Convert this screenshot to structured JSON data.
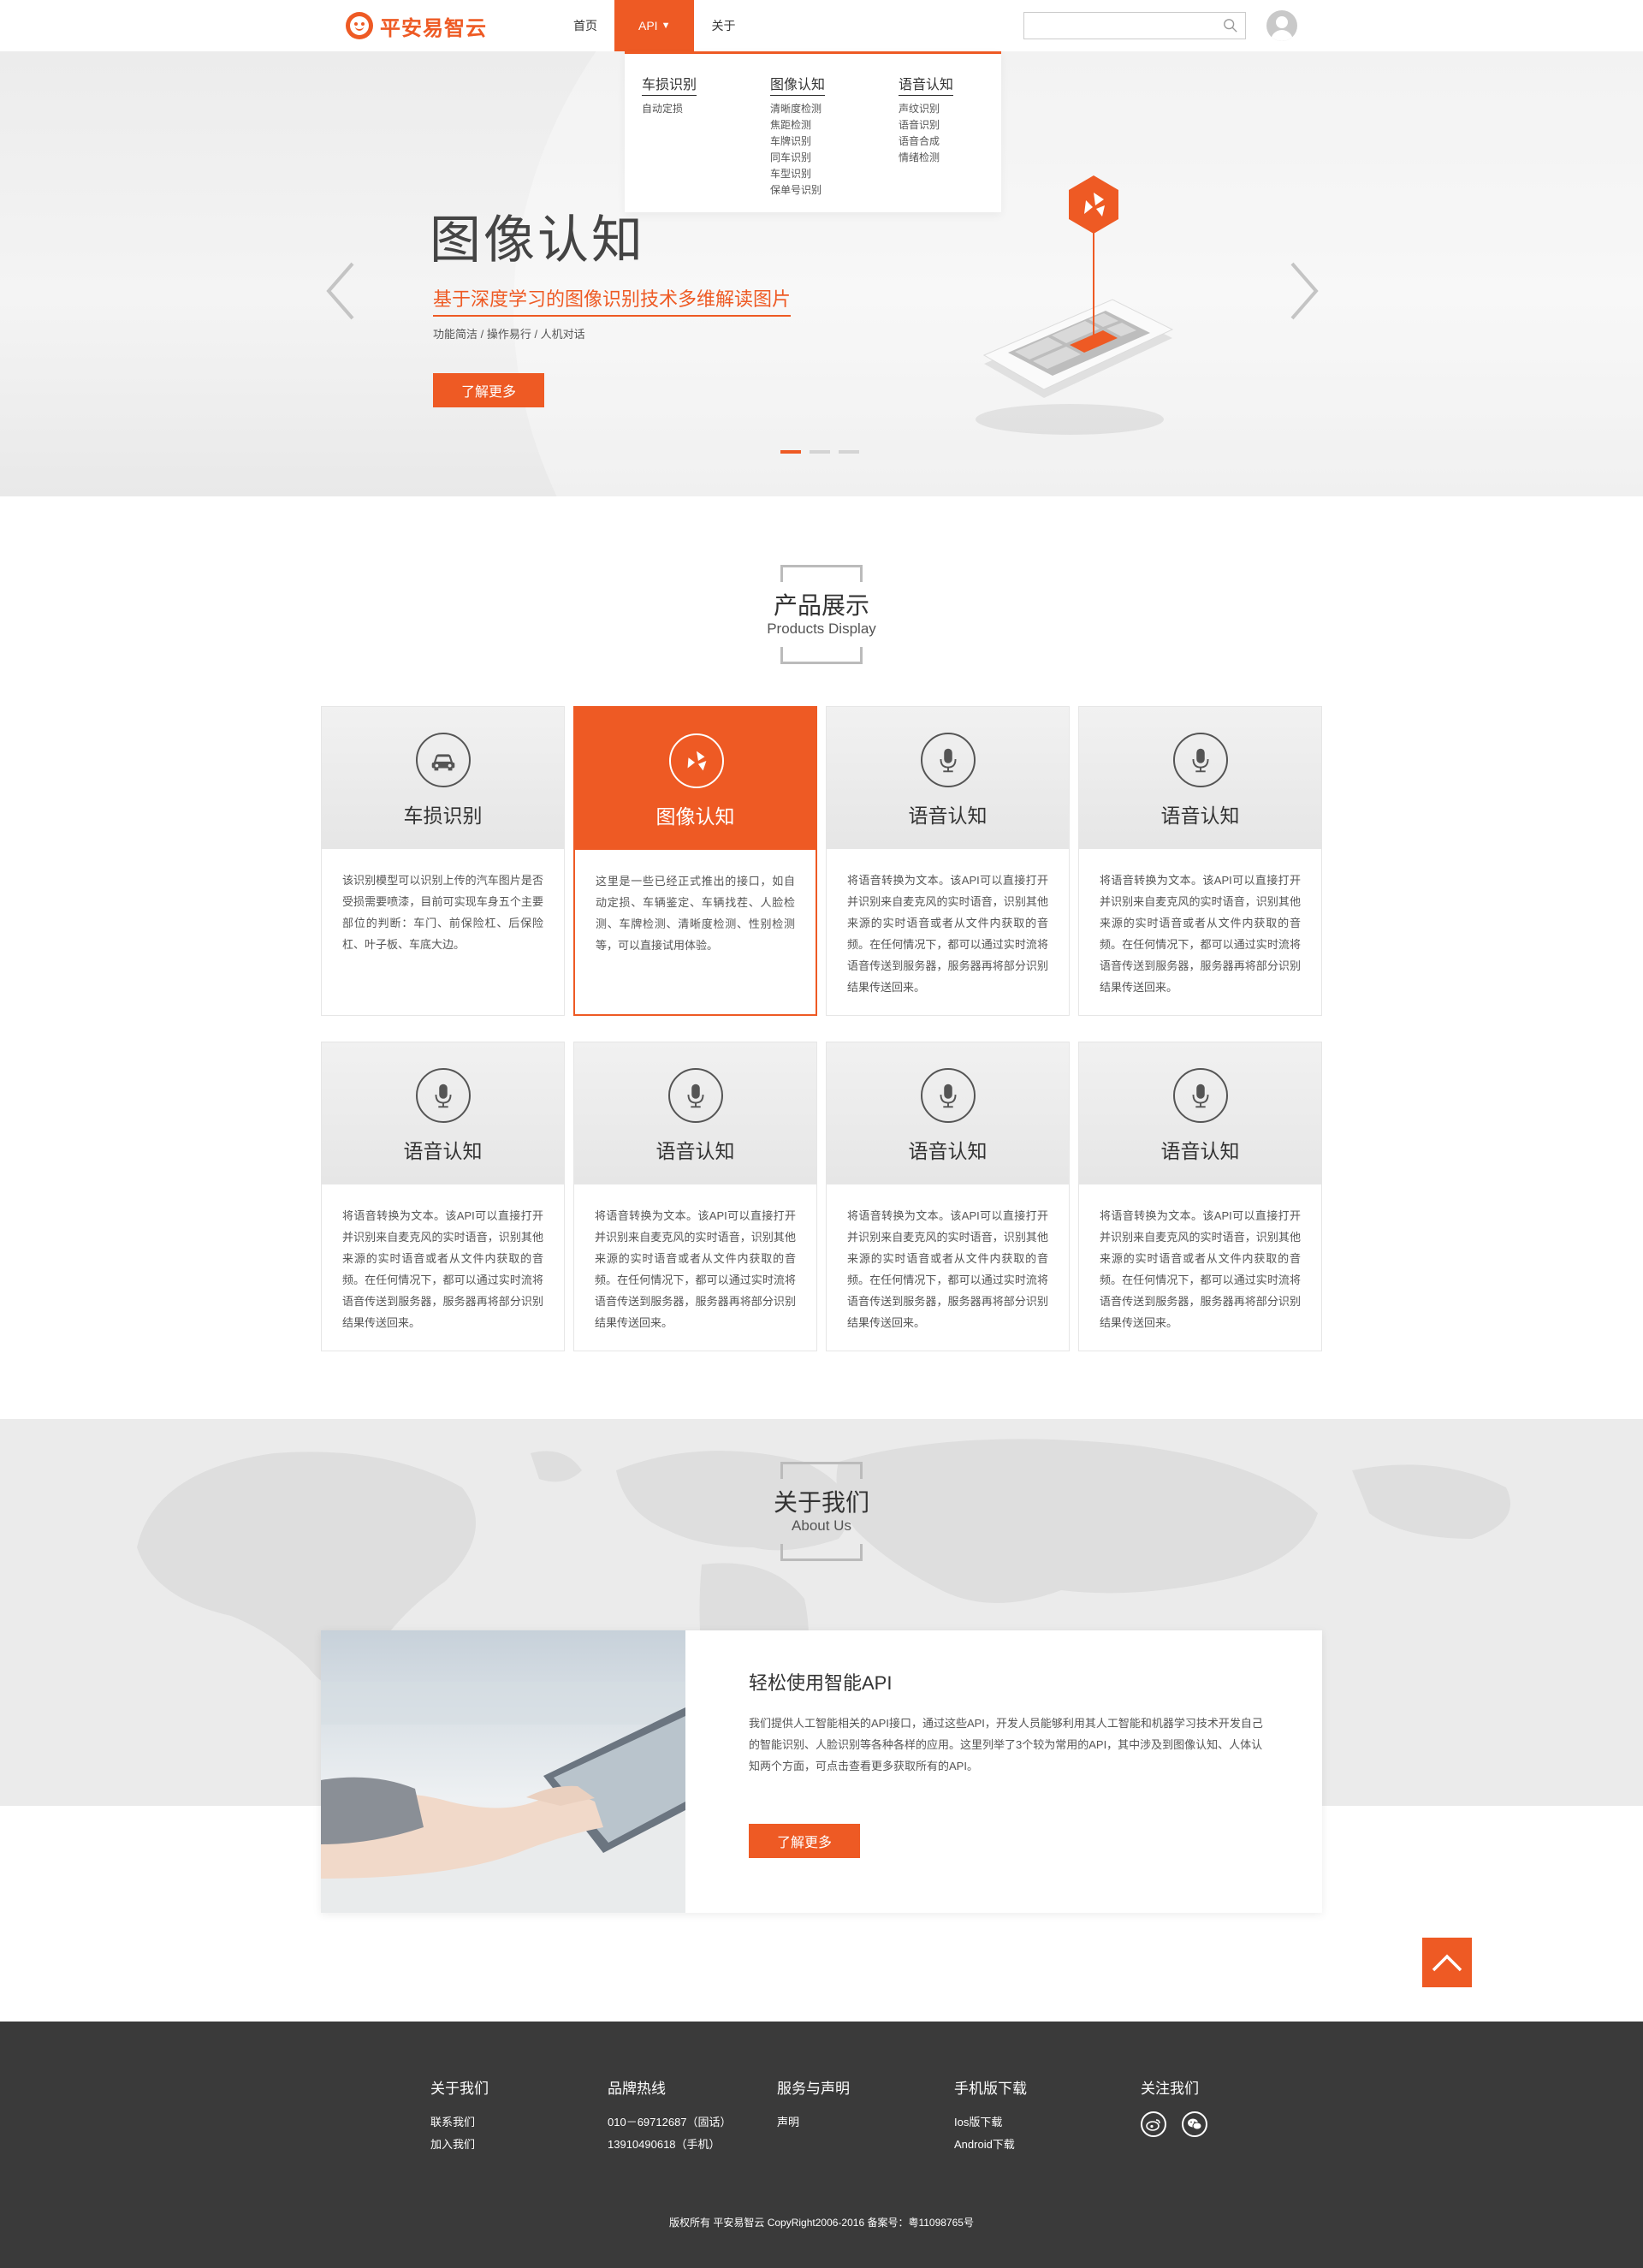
{
  "header": {
    "logo_text": "平安易智云",
    "nav": [
      {
        "label": "首页"
      },
      {
        "label": "API",
        "caret": "▼"
      },
      {
        "label": "关于"
      }
    ],
    "search_placeholder": ""
  },
  "dropdown": {
    "columns": [
      {
        "title": "车损识别",
        "items": [
          "自动定损"
        ]
      },
      {
        "title": "图像认知",
        "items": [
          "清晰度检测",
          "焦距检测",
          "车牌识别",
          "同车识别",
          "车型识别",
          "保单号识别"
        ]
      },
      {
        "title": "语音认知",
        "items": [
          "声纹识别",
          "语音识别",
          "语音合成",
          "情绪检测"
        ]
      }
    ]
  },
  "banner": {
    "title": "图像认知",
    "subtitle": "基于深度学习的图像识别技术多维解读图片",
    "desc": "功能简洁 / 操作易行 / 人机对话",
    "button": "了解更多",
    "slides_total": 3,
    "active_slide": 1
  },
  "products": {
    "title": "产品展示",
    "subtitle": "Products Display",
    "cards": [
      {
        "title": "车损识别",
        "icon": "car-icon",
        "text": "该识别模型可以识别上传的汽车图片是否受损需要喷漆，目前可实现车身五个主要部位的判断：车门、前保险杠、后保险杠、叶子板、车底大边。"
      },
      {
        "title": "图像认知",
        "icon": "image-cognition-icon",
        "text": "这里是一些已经正式推出的接口，如自动定损、车辆鉴定、车辆找茬、人脸检测、车牌检测、清晰度检测、性别检测等，可以直接试用体验。"
      },
      {
        "title": "语音认知",
        "icon": "microphone-icon",
        "text": "将语音转换为文本。该API可以直接打开并识别来自麦克风的实时语音，识别其他来源的实时语音或者从文件内获取的音频。在任何情况下，都可以通过实时流将语音传送到服务器，服务器再将部分识别结果传送回来。"
      },
      {
        "title": "语音认知",
        "icon": "microphone-icon",
        "text": "将语音转换为文本。该API可以直接打开并识别来自麦克风的实时语音，识别其他来源的实时语音或者从文件内获取的音频。在任何情况下，都可以通过实时流将语音传送到服务器，服务器再将部分识别结果传送回来。"
      },
      {
        "title": "语音认知",
        "icon": "microphone-icon",
        "text": "将语音转换为文本。该API可以直接打开并识别来自麦克风的实时语音，识别其他来源的实时语音或者从文件内获取的音频。在任何情况下，都可以通过实时流将语音传送到服务器，服务器再将部分识别结果传送回来。"
      },
      {
        "title": "语音认知",
        "icon": "microphone-icon",
        "text": "将语音转换为文本。该API可以直接打开并识别来自麦克风的实时语音，识别其他来源的实时语音或者从文件内获取的音频。在任何情况下，都可以通过实时流将语音传送到服务器，服务器再将部分识别结果传送回来。"
      },
      {
        "title": "语音认知",
        "icon": "microphone-icon",
        "text": "将语音转换为文本。该API可以直接打开并识别来自麦克风的实时语音，识别其他来源的实时语音或者从文件内获取的音频。在任何情况下，都可以通过实时流将语音传送到服务器，服务器再将部分识别结果传送回来。"
      },
      {
        "title": "语音认知",
        "icon": "microphone-icon",
        "text": "将语音转换为文本。该API可以直接打开并识别来自麦克风的实时语音，识别其他来源的实时语音或者从文件内获取的音频。在任何情况下，都可以通过实时流将语音传送到服务器，服务器再将部分识别结果传送回来。"
      }
    ]
  },
  "about": {
    "title": "关于我们",
    "subtitle": "About Us",
    "card_title": "轻松使用智能API",
    "card_text": "我们提供人工智能相关的API接口，通过这些API，开发人员能够利用其人工智能和机器学习技术开发自己的智能识别、人脸识别等各种各样的应用。这里列举了3个较为常用的API，其中涉及到图像认知、人体认知两个方面，可点击查看更多获取所有的API。",
    "button": "了解更多"
  },
  "footer": {
    "columns": [
      {
        "title": "关于我们",
        "links": [
          "联系我们",
          "加入我们"
        ]
      },
      {
        "title": "品牌热线",
        "links": [
          "010－69712687（固话）",
          "13910490618（手机）"
        ]
      },
      {
        "title": "服务与声明",
        "links": [
          "声明"
        ]
      },
      {
        "title": "手机版下载",
        "links": [
          "Ios版下载",
          "Android下载"
        ]
      },
      {
        "title": "关注我们",
        "links": []
      }
    ],
    "copyright": "版权所有 平安易智云 CopyRight2006-2016 备案号：粤11098765号"
  },
  "colors": {
    "accent": "#ee5a24",
    "footer_bg": "#3a3a3a",
    "banner_bg": "#ececec"
  }
}
